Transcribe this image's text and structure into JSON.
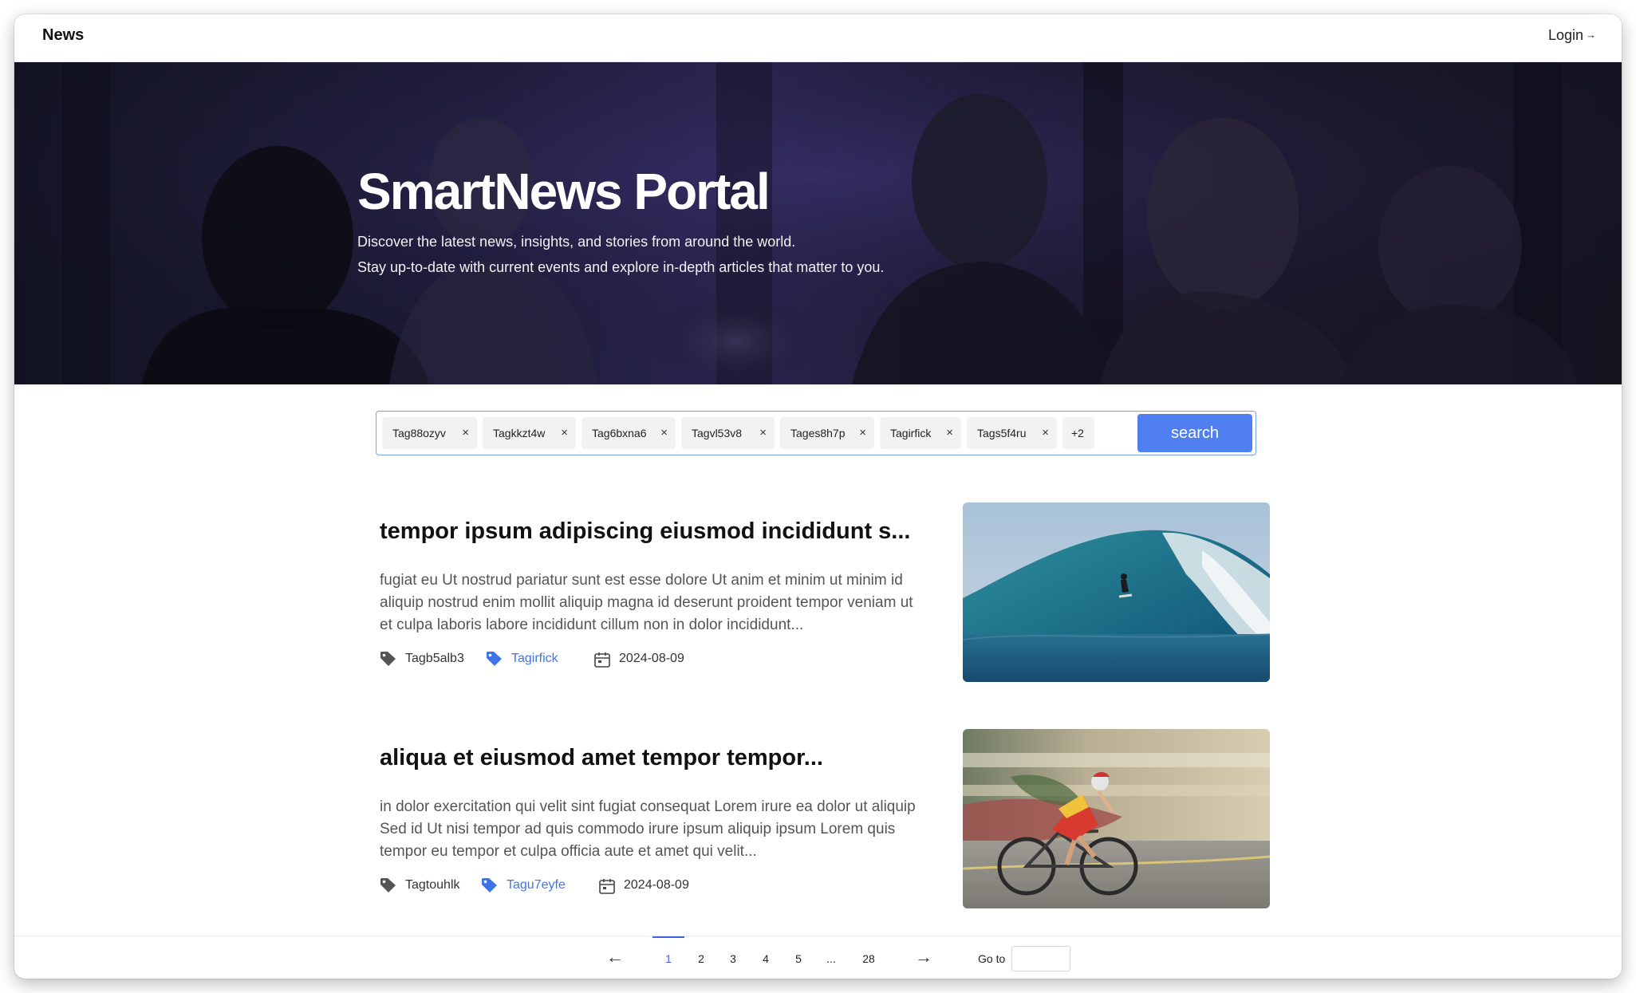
{
  "nav": {
    "brand": "News",
    "login_label": "Login"
  },
  "hero": {
    "title": "SmartNews Portal",
    "subtitle_line1": "Discover the latest news, insights, and stories from around the world.",
    "subtitle_line2": "Stay up-to-date with current events and explore in-depth articles that matter to you."
  },
  "search": {
    "tags": [
      "Tag88ozyv",
      "Tagkkzt4w",
      "Tag6bxna6",
      "Tagvl53v8",
      "Tages8h7p",
      "Tagirfick",
      "Tags5f4ru"
    ],
    "more_count": "+2",
    "button_label": "search"
  },
  "articles": [
    {
      "title": "tempor ipsum adipiscing eiusmod incididunt s...",
      "excerpt": "fugiat eu Ut nostrud pariatur sunt est esse dolore Ut anim et minim ut minim id aliquip nostrud enim mollit aliquip magna id deserunt proident tempor veniam ut et culpa laboris labore incididunt cillum non in dolor incididunt...",
      "tag1": "Tagb5alb3",
      "tag2": "Tagirfick",
      "date": "2024-08-09",
      "image": "surfer-photo"
    },
    {
      "title": "aliqua et eiusmod amet tempor tempor...",
      "excerpt": "in dolor exercitation qui velit sint fugiat consequat Lorem irure ea dolor ut aliquip Sed id Ut nisi tempor ad quis commodo irure ipsum aliquip ipsum Lorem quis tempor eu tempor et culpa officia aute et amet qui velit...",
      "tag1": "Tagtouhlk",
      "tag2": "Tagu7eyfe",
      "date": "2024-08-09",
      "image": "cyclist-photo"
    }
  ],
  "pagination": {
    "prev": "←",
    "pages": [
      "1",
      "2",
      "3",
      "4",
      "5",
      "...",
      "28"
    ],
    "current_page": "1",
    "next": "→",
    "goto_label": "Go to",
    "goto_value": ""
  },
  "colors": {
    "accent": "#4f7ff1",
    "tag_blue": "#3f74e8",
    "hero_dark": "#1d1c38"
  }
}
